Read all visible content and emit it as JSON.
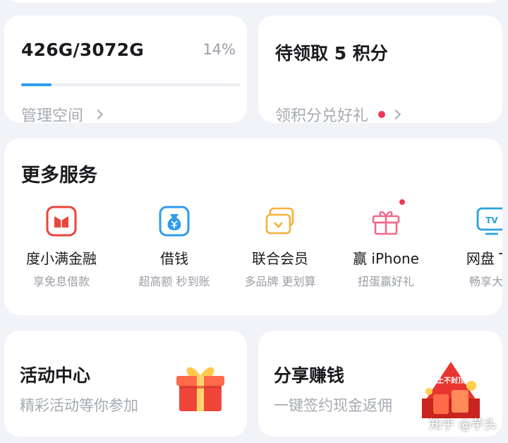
{
  "storage": {
    "used_label": "426G/3072G",
    "percent_label": "14%",
    "percent_value": 14,
    "manage_label": "管理空间",
    "bar_color": "#2f9bef"
  },
  "points": {
    "title": "待领取 5 积分",
    "link_label": "领积分兑好礼"
  },
  "services": {
    "title": "更多服务",
    "items": [
      {
        "name": "度小满金融",
        "sub": "享免息借款",
        "icon": "duxiaoman-finance-icon"
      },
      {
        "name": "借钱",
        "sub": "超高额 秒到账",
        "icon": "money-bag-icon"
      },
      {
        "name": "联合会员",
        "sub": "多品牌 更划算",
        "icon": "membership-cards-icon"
      },
      {
        "name": "赢 iPhone",
        "sub": "扭蛋赢好礼",
        "icon": "gift-box-icon"
      },
      {
        "name": "网盘 TV",
        "sub": "畅享大屏",
        "icon": "tv-icon"
      }
    ]
  },
  "activity": {
    "title": "活动中心",
    "subtitle": "精彩活动等你参加"
  },
  "share": {
    "title": "分享赚钱",
    "subtitle": "一键签约现金返佣",
    "art_text": "上不封顶"
  },
  "watermark": "知乎 @芋头",
  "colors": {
    "accent_blue": "#2f9bef",
    "badge_red": "#ee3b5a",
    "background": "#f1f3f8"
  }
}
